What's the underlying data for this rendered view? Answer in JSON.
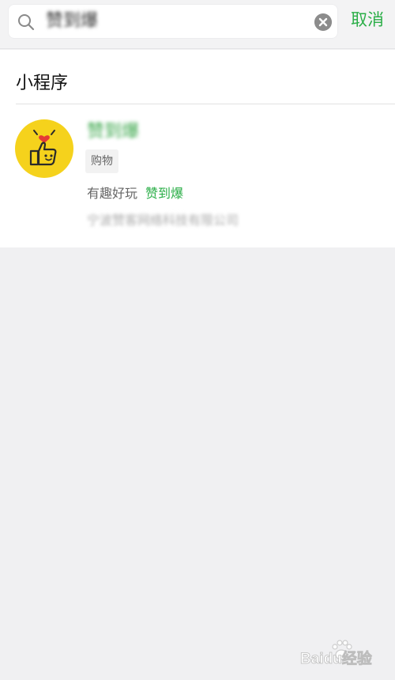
{
  "search": {
    "query": "赞到爆",
    "icon": "search-icon",
    "clear_icon": "clear-icon",
    "cancel_label": "取消"
  },
  "results": {
    "section_title": "小程序",
    "items": [
      {
        "name": "赞到爆",
        "category": "购物",
        "description": "有趣好玩",
        "highlight": "赞到爆",
        "company": "宁波赞客网络科技有限公司",
        "logo_icon": "thumbs-up-logo-icon",
        "logo_color": "#f5d21c"
      }
    ]
  },
  "watermark": {
    "brand": "Baidu经验",
    "icon": "paw-icon"
  },
  "colors": {
    "accent": "#2aae47",
    "background": "#f0f0f2",
    "panel": "#ffffff"
  }
}
